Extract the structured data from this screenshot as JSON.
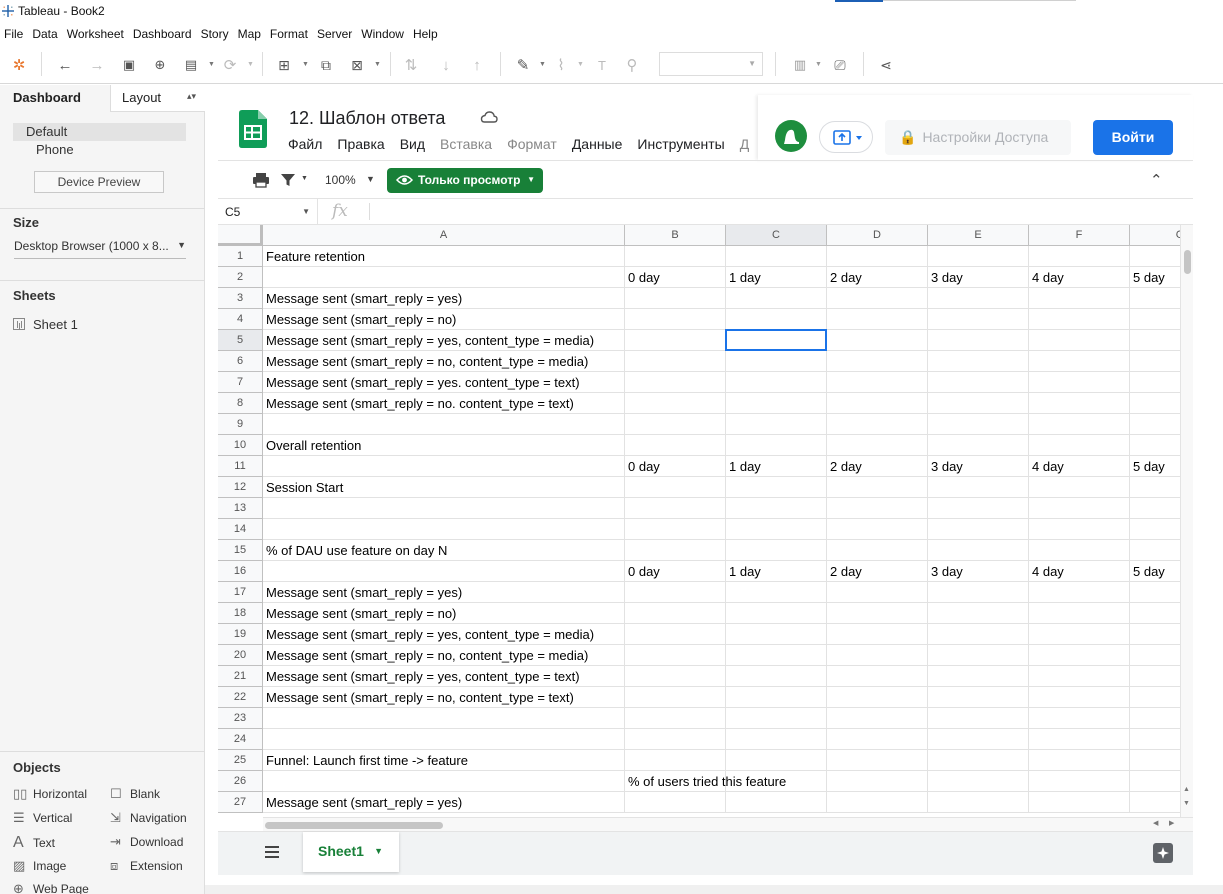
{
  "window": {
    "title": "Tableau - Book2"
  },
  "menu": [
    "File",
    "Data",
    "Worksheet",
    "Dashboard",
    "Story",
    "Map",
    "Format",
    "Server",
    "Window",
    "Help"
  ],
  "toolbar": {
    "icons": [
      "tableau-logo-icon",
      "undo-icon",
      "redo-icon",
      "save-icon",
      "new-datasource-icon",
      "pause-icon",
      "refresh-icon",
      "new-worksheet-icon",
      "duplicate-icon",
      "clear-icon",
      "swap-icon",
      "sort-asc-icon",
      "sort-desc-icon",
      "highlight-icon",
      "attach-icon",
      "text-icon",
      "pin-icon",
      "show-me-icon",
      "presentation-icon",
      "share-icon"
    ],
    "fit_dropdown_value": ""
  },
  "left_panel": {
    "tabs": [
      "Dashboard",
      "Layout"
    ],
    "devices": [
      "Default",
      "Phone"
    ],
    "device_preview_label": "Device Preview",
    "size_header": "Size",
    "size_value": "Desktop Browser (1000 x 8...",
    "sheets_header": "Sheets",
    "sheets": [
      "Sheet 1"
    ],
    "objects_header": "Objects",
    "objects": [
      {
        "label": "Horizontal",
        "icon": "horizontal-icon"
      },
      {
        "label": "Blank",
        "icon": "blank-icon"
      },
      {
        "label": "Vertical",
        "icon": "vertical-icon"
      },
      {
        "label": "Navigation",
        "icon": "navigation-icon"
      },
      {
        "label": "Text",
        "icon": "text-icon"
      },
      {
        "label": "Download",
        "icon": "download-icon"
      },
      {
        "label": "Image",
        "icon": "image-icon"
      },
      {
        "label": "Extension",
        "icon": "extension-icon"
      },
      {
        "label": "Web Page",
        "icon": "globe-icon"
      }
    ]
  },
  "sheets_app": {
    "doc_title": "12. Шаблон ответа",
    "menu": [
      {
        "label": "Файл",
        "dim": false
      },
      {
        "label": "Правка",
        "dim": false
      },
      {
        "label": "Вид",
        "dim": false
      },
      {
        "label": "Вставка",
        "dim": true
      },
      {
        "label": "Формат",
        "dim": true
      },
      {
        "label": "Данные",
        "dim": false
      },
      {
        "label": "Инструменты",
        "dim": false
      },
      {
        "label": "Д",
        "dim": true
      }
    ],
    "share_label": "Настройки Доступа",
    "login_label": "Войти",
    "zoom": "100%",
    "view_only_label": "Только просмотр",
    "name_box": "C5",
    "fx_label": "fx",
    "columns": [
      "A",
      "B",
      "C",
      "D",
      "E",
      "F",
      "G"
    ],
    "selected_cell": {
      "col": "C",
      "row": 5
    },
    "rows": [
      {
        "n": "1",
        "a": "Feature retention",
        "cells": []
      },
      {
        "n": "2",
        "a": "",
        "cells": [
          "0 day",
          "1 day",
          "2 day",
          "3 day",
          "4 day",
          "5 day"
        ]
      },
      {
        "n": "3",
        "a": "Message sent (smart_reply = yes)",
        "cells": []
      },
      {
        "n": "4",
        "a": "Message sent (smart_reply = no)",
        "cells": []
      },
      {
        "n": "5",
        "a": "Message sent (smart_reply = yes, content_type = media)",
        "cells": []
      },
      {
        "n": "6",
        "a": "Message sent (smart_reply = no, content_type = media)",
        "cells": []
      },
      {
        "n": "7",
        "a": "Message sent (smart_reply = yes. content_type = text)",
        "cells": []
      },
      {
        "n": "8",
        "a": "Message sent (smart_reply = no. content_type = text)",
        "cells": []
      },
      {
        "n": "9",
        "a": "",
        "cells": []
      },
      {
        "n": "10",
        "a": "Overall retention",
        "cells": []
      },
      {
        "n": "11",
        "a": "",
        "cells": [
          "0 day",
          "1 day",
          "2 day",
          "3 day",
          "4 day",
          "5 day"
        ]
      },
      {
        "n": "12",
        "a": "Session Start",
        "cells": []
      },
      {
        "n": "13",
        "a": "",
        "cells": []
      },
      {
        "n": "14",
        "a": "",
        "cells": []
      },
      {
        "n": "15",
        "a": "% of DAU use feature on day N",
        "cells": []
      },
      {
        "n": "16",
        "a": "",
        "cells": [
          "0 day",
          "1 day",
          "2 day",
          "3 day",
          "4 day",
          "5 day"
        ]
      },
      {
        "n": "17",
        "a": "Message sent (smart_reply = yes)",
        "cells": []
      },
      {
        "n": "18",
        "a": "Message sent (smart_reply = no)",
        "cells": []
      },
      {
        "n": "19",
        "a": "Message sent (smart_reply = yes, content_type = media)",
        "cells": []
      },
      {
        "n": "20",
        "a": "Message sent (smart_reply = no, content_type = media)",
        "cells": []
      },
      {
        "n": "21",
        "a": "Message sent (smart_reply = yes, content_type = text)",
        "cells": []
      },
      {
        "n": "22",
        "a": "Message sent (smart_reply = no, content_type = text)",
        "cells": []
      },
      {
        "n": "23",
        "a": "",
        "cells": []
      },
      {
        "n": "24",
        "a": "",
        "cells": []
      },
      {
        "n": "25",
        "a": "Funnel: Launch first time -> feature",
        "cells": []
      },
      {
        "n": "26",
        "a": "",
        "cells": [
          "% of users tried this feature"
        ]
      },
      {
        "n": "27",
        "a": "Message sent (smart_reply = yes)",
        "cells": []
      }
    ],
    "sheet_tab": "Sheet1"
  },
  "colors": {
    "sheets_green": "#188038",
    "login_blue": "#1a73e8",
    "selection_blue": "#1a73e8"
  }
}
